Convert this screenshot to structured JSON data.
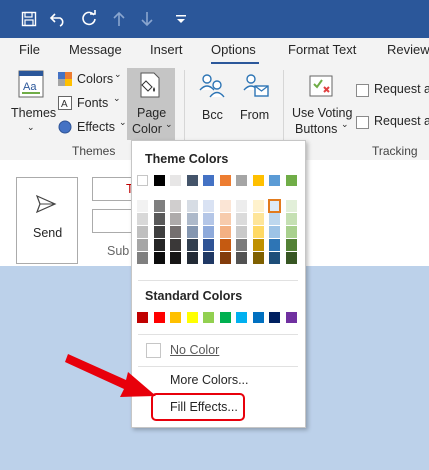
{
  "titlebar": {
    "icons": [
      "save-icon",
      "undo-icon",
      "redo-icon",
      "up-arrow-icon",
      "down-arrow-icon",
      "customize-chevron-icon"
    ]
  },
  "tabs": [
    {
      "label": "File"
    },
    {
      "label": "Message"
    },
    {
      "label": "Insert"
    },
    {
      "label": "Options"
    },
    {
      "label": "Format Text"
    },
    {
      "label": "Review"
    }
  ],
  "ribbon": {
    "themes_label": "Themes",
    "colors_label": "Colors",
    "fonts_label": "Fonts",
    "effects_label": "Effects",
    "page_color_line1": "Page",
    "page_color_line2": "Color",
    "themes_group": "Themes",
    "bcc_label": "Bcc",
    "from_label": "From",
    "voting_line1": "Use Voting",
    "voting_line2": "Buttons",
    "request1": "Request a",
    "request2": "Request a",
    "tracking_group": "Tracking"
  },
  "compose": {
    "send_label": "Send",
    "to_partial": "T",
    "subject_partial": "Sub"
  },
  "dropdown": {
    "theme_colors_title": "Theme Colors",
    "standard_colors_title": "Standard Colors",
    "no_color": "No Color",
    "more_colors": "More Colors...",
    "fill_effects": "Fill Effects...",
    "theme_top": [
      "#ffffff",
      "#000000",
      "#e7e6e6",
      "#44546a",
      "#4472c4",
      "#ed7d31",
      "#a5a5a5",
      "#ffc000",
      "#5b9bd5",
      "#70ad47"
    ],
    "theme_shades": [
      [
        "#f2f2f2",
        "#7f7f7f",
        "#d0cece",
        "#d6dce4",
        "#d9e2f3",
        "#fbe5d5",
        "#ededed",
        "#fff2cc",
        "#deebf6",
        "#e2efd9"
      ],
      [
        "#d8d8d8",
        "#595959",
        "#aeabab",
        "#adb9ca",
        "#b4c6e7",
        "#f7cbac",
        "#dbdbdb",
        "#fee599",
        "#bdd7ee",
        "#c5e0b3"
      ],
      [
        "#bfbfbf",
        "#3f3f3f",
        "#757070",
        "#8496b0",
        "#8eaadb",
        "#f4b183",
        "#c9c9c9",
        "#ffd965",
        "#9dc3e6",
        "#a8d08d"
      ],
      [
        "#a5a5a5",
        "#262626",
        "#3a3838",
        "#323f4f",
        "#2f5496",
        "#c55a11",
        "#7b7b7b",
        "#bf9000",
        "#2e75b5",
        "#538135"
      ],
      [
        "#7f7f7f",
        "#0c0c0c",
        "#171616",
        "#222a35",
        "#1f3864",
        "#833c0b",
        "#525252",
        "#7f6000",
        "#1e4e79",
        "#375623"
      ]
    ],
    "standard": [
      "#c00000",
      "#ff0000",
      "#ffc000",
      "#ffff00",
      "#92d050",
      "#00b050",
      "#00b0f0",
      "#0070c0",
      "#002060",
      "#7030a0"
    ]
  },
  "annotation": {
    "arrow_color": "#e8000b",
    "highlight_color": "#e8000b"
  }
}
